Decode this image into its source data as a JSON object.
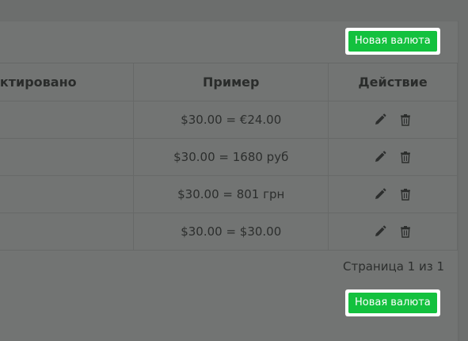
{
  "toolbar": {
    "new_currency_label": "Новая валюта"
  },
  "table": {
    "columns": [
      "ектировано",
      "Пример",
      "Действие"
    ],
    "rows": [
      {
        "edited": "",
        "example": "$30.00 = €24.00",
        "actions": [
          "pencil-icon",
          "trash-icon"
        ]
      },
      {
        "edited": "",
        "example": "$30.00 = 1680 руб",
        "actions": [
          "pencil-icon",
          "trash-icon"
        ]
      },
      {
        "edited": "",
        "example": "$30.00 = 801 грн",
        "actions": [
          "pencil-icon",
          "trash-icon"
        ]
      },
      {
        "edited": "",
        "example": "$30.00 = $30.00",
        "actions": [
          "pencil-icon",
          "trash-icon"
        ]
      }
    ]
  },
  "pagination": {
    "text": "Страница 1 из 1"
  },
  "footer": {
    "new_currency_label": "Новая валюта"
  },
  "colors": {
    "accent": "#13c13e",
    "overlay_background": "#727473",
    "text": "#2b2d2c"
  }
}
